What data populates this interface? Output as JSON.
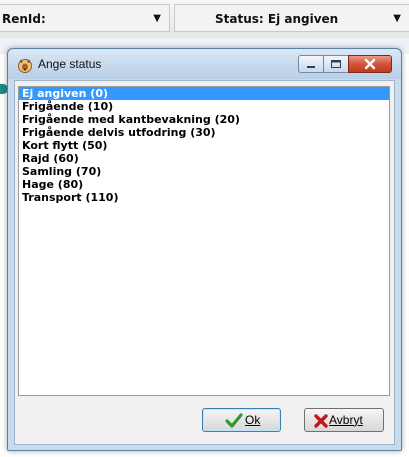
{
  "background": {
    "renid_label": "RenId:",
    "status_label": "Status: Ej angiven"
  },
  "dialog": {
    "title": "Ange status",
    "items": [
      "Ej angiven (0)",
      "Frigående (10)",
      "Frigående med kantbevakning (20)",
      "Frigående delvis utfodring (30)",
      "Kort flytt (50)",
      "Rajd (60)",
      "Samling (70)",
      "Hage (80)",
      "Transport (110)"
    ],
    "selected_index": 0,
    "ok_label": "Ok",
    "cancel_label": "Avbryt"
  },
  "colors": {
    "selection": "#3399ff",
    "close_button": "#c23a1f",
    "ok_icon": "#2e9a2e",
    "cancel_icon": "#c0171b"
  },
  "icons": {
    "app": "reindeer-icon",
    "ok": "check-icon",
    "cancel": "x-icon"
  }
}
